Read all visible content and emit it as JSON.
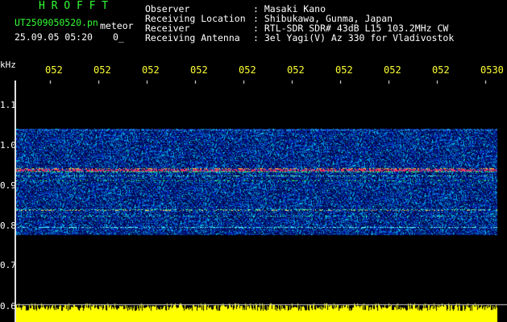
{
  "header": {
    "app_title": "H R O F F T",
    "filename": "UT2509050520.pn",
    "meteor_label": "meteor",
    "datetime": "25.09.05 05:20",
    "count_text": "0_",
    "info_labels": [
      "Observer",
      "Receiving Location",
      "Receiver",
      "Receiving Antenna"
    ],
    "info_values": [
      ": Masaki Kano",
      ": Shibukawa, Gunma, Japan",
      ": RTL-SDR SDR# 43dB L15 103.2MHz CW",
      ": 3el Yagi(V) Az 330 for Vladivostok"
    ]
  },
  "axis": {
    "y_unit": "kHz",
    "y_ticks": [
      "1.1",
      "1.0",
      "0.9",
      "0.8",
      "0.7",
      "0.6"
    ],
    "x_ticks": [
      "052",
      "052",
      "052",
      "052",
      "052",
      "052",
      "052",
      "052",
      "052",
      "0530"
    ]
  },
  "colors": {
    "title_green": "#33ff33",
    "text_white": "#ffffff",
    "tick_yellow": "#ffff33",
    "bg": "#000000"
  }
}
